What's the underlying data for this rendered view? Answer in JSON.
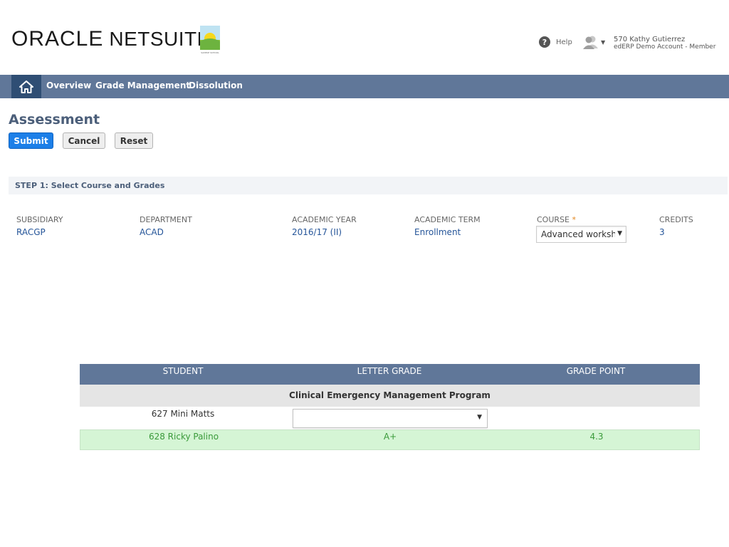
{
  "header": {
    "brand_oracle": "ORACLE",
    "brand_netsuite": "NETSUITE",
    "school_logo_caption": "SAMPLE SCHOOL",
    "help_label": "Help",
    "user_name": "570 Kathy Gutierrez",
    "user_account": "edERP Demo Account - Member"
  },
  "nav": {
    "items": [
      {
        "label": "Overview"
      },
      {
        "label": "Grade Management"
      },
      {
        "label": "Dissolution"
      }
    ]
  },
  "page": {
    "title": "Assessment",
    "buttons": {
      "submit": "Submit",
      "cancel": "Cancel",
      "reset": "Reset"
    }
  },
  "step1": {
    "label": "STEP 1: Select Course and Grades",
    "fields": {
      "subsidiary": {
        "label": "SUBSIDIARY",
        "value": "RACGP"
      },
      "department": {
        "label": "DEPARTMENT",
        "value": "ACAD"
      },
      "academic_year": {
        "label": "ACADEMIC YEAR",
        "value": "2016/17 (II)"
      },
      "academic_term": {
        "label": "ACADEMIC TERM",
        "value": "Enrollment"
      },
      "course": {
        "label": "COURSE",
        "required_mark": "*",
        "value": "Advanced workshop"
      },
      "credits": {
        "label": "CREDITS",
        "value": "3"
      }
    }
  },
  "grades_table": {
    "columns": {
      "student": "STUDENT",
      "letter_grade": "LETTER GRADE",
      "grade_point": "GRADE POINT"
    },
    "group": "Clinical Emergency Management Program",
    "rows": [
      {
        "student": "627 Mini Matts",
        "letter_grade": "",
        "grade_point": ""
      },
      {
        "student": "628 Ricky Palino",
        "letter_grade": "A+",
        "grade_point": "4.3"
      }
    ]
  },
  "colors": {
    "nav_bg": "#607799",
    "nav_home_bg": "#2f4e74",
    "primary_button": "#1c7fe8",
    "link_value": "#255599",
    "graded_row_bg": "#d5f5d5",
    "graded_row_text": "#3a9a3a"
  }
}
